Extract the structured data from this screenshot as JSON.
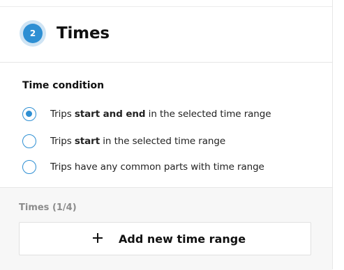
{
  "step": {
    "number": "2",
    "title": "Times",
    "badge_color": "#2e8fd3"
  },
  "time_condition": {
    "title": "Time condition",
    "options": [
      {
        "prefix": "Trips ",
        "emphasis": "start and end",
        "suffix": " in the selected time range",
        "selected": true
      },
      {
        "prefix": "Trips ",
        "emphasis": "start",
        "suffix": " in the selected time range",
        "selected": false
      },
      {
        "prefix": "Trips have any common parts with time range",
        "emphasis": "",
        "suffix": "",
        "selected": false
      }
    ]
  },
  "times": {
    "label": "Times (1/4)",
    "add_button_label": "Add new time range",
    "add_icon": "plus-icon"
  }
}
